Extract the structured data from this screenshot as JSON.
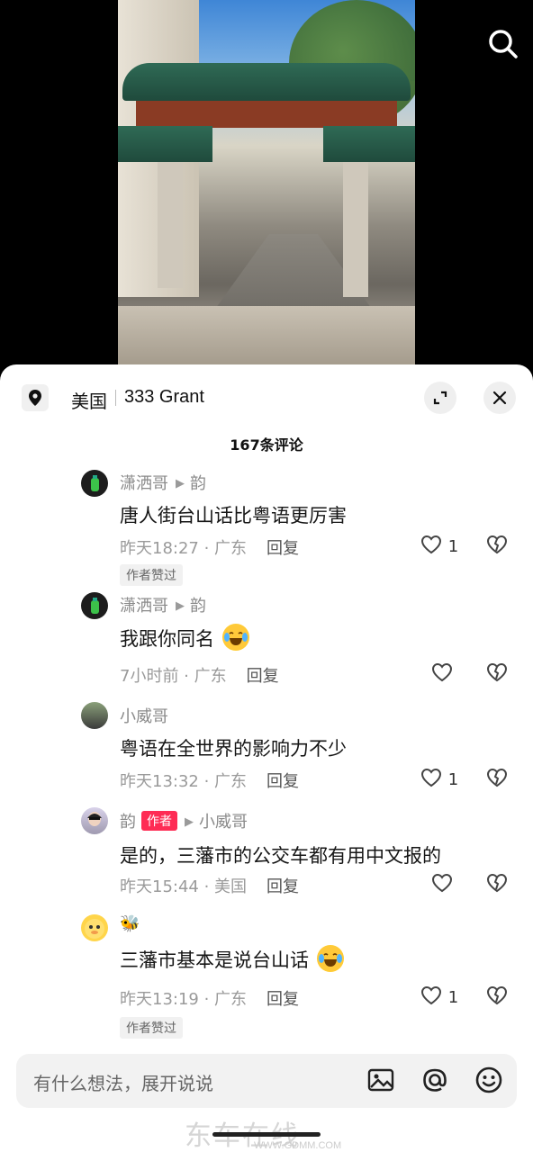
{
  "location": {
    "country": "美国",
    "address": "333 Grant"
  },
  "comments_count": "167条评论",
  "comments": [
    {
      "user": "潇洒哥",
      "reply_to": "韵",
      "text": "唐人街台山话比粤语更厉害",
      "time": "昨天18:27 · 广东",
      "reply_label": "回复",
      "likes": "1",
      "author_liked": "作者赞过"
    },
    {
      "user": "潇洒哥",
      "reply_to": "韵",
      "text": "我跟你同名",
      "time": "7小时前 · 广东",
      "reply_label": "回复",
      "likes": ""
    },
    {
      "user": "小威哥",
      "text": "粤语在全世界的影响力不少",
      "time": "昨天13:32 · 广东",
      "reply_label": "回复",
      "likes": "1"
    },
    {
      "user": "韵",
      "author_badge": "作者",
      "reply_to": "小威哥",
      "text": "是的，三藩市的公交车都有用中文报的",
      "time": "昨天15:44 · 美国",
      "reply_label": "回复",
      "likes": ""
    },
    {
      "user": "🐝",
      "text": "三藩市基本是说台山话",
      "time": "昨天13:19 · 广东",
      "reply_label": "回复",
      "likes": "1",
      "author_liked": "作者赞过"
    }
  ],
  "input": {
    "placeholder": "有什么想法，展开说说"
  },
  "icons": [
    "search-icon",
    "location-pin-icon",
    "expand-icon",
    "close-icon",
    "heart-icon",
    "broken-heart-icon",
    "image-icon",
    "at-icon",
    "emoji-icon"
  ],
  "watermark": {
    "main": "东车在线",
    "sub": "WWW.GDMM.COM"
  },
  "colors": {
    "accent": "#fe2c55",
    "meta": "#9a9a9a",
    "sheet": "#ffffff"
  }
}
